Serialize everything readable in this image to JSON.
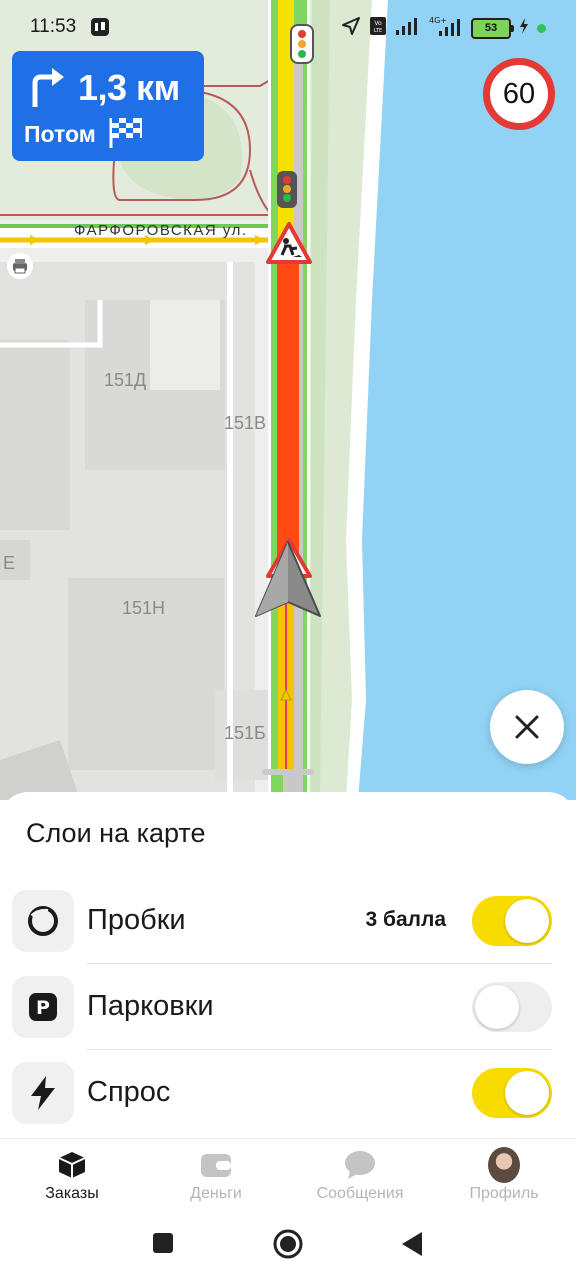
{
  "status_bar": {
    "time": "11:53",
    "battery": "53"
  },
  "maneuver": {
    "distance": "1,3 км",
    "next_label": "Потом"
  },
  "speed_limit": "60",
  "map": {
    "street_name": "ФАРФОРОВСКАЯ ул.",
    "buildings": [
      "151Д",
      "151В",
      "151Н",
      "151Б",
      "Е"
    ]
  },
  "layers_panel": {
    "title": "Слои на карте",
    "items": [
      {
        "label": "Пробки",
        "value": "3 балла",
        "enabled": true,
        "icon": "traffic-icon"
      },
      {
        "label": "Парковки",
        "value": "",
        "enabled": false,
        "icon": "parking-icon"
      },
      {
        "label": "Спрос",
        "value": "",
        "enabled": true,
        "icon": "lightning-icon"
      }
    ]
  },
  "bottom_nav": {
    "tabs": [
      {
        "label": "Заказы",
        "icon": "cube-icon",
        "active": true
      },
      {
        "label": "Деньги",
        "icon": "wallet-icon",
        "active": false
      },
      {
        "label": "Сообщения",
        "icon": "chat-icon",
        "active": false
      },
      {
        "label": "Профиль",
        "icon": "avatar",
        "active": false
      }
    ]
  },
  "colors": {
    "maneuver_blue": "#1f6fe6",
    "route_heavy": "#ff4a14",
    "route_free": "#58c93c",
    "toggle_on": "#f8dc00",
    "water": "#92d3f5"
  }
}
